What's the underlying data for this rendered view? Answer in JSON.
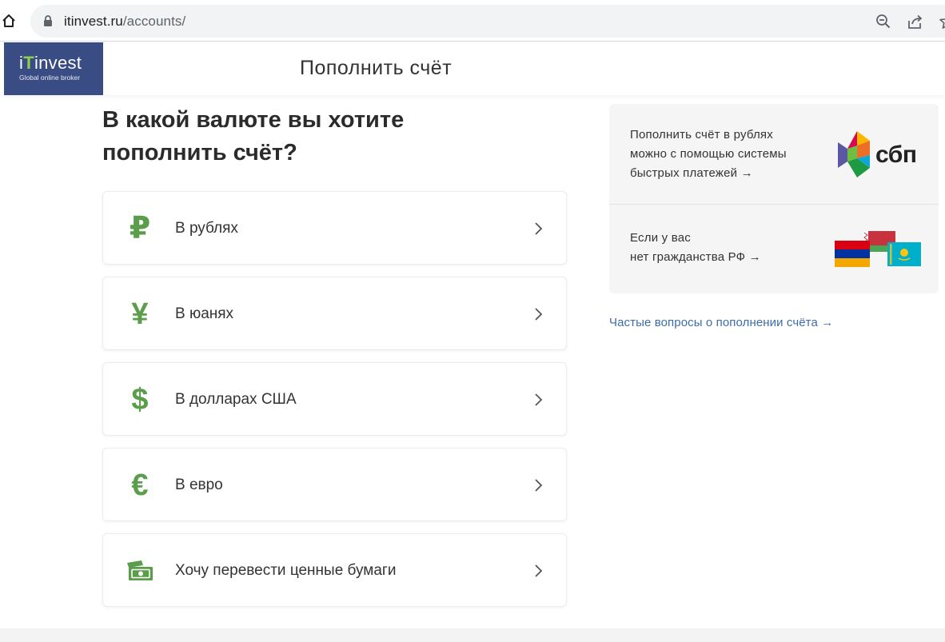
{
  "browser": {
    "url_host": "itinvest.ru",
    "url_path": "/accounts/"
  },
  "header": {
    "logo_main_prefix": "i",
    "logo_main_t": "T",
    "logo_main_rest": "invest",
    "logo_sub": "Global online broker",
    "title": "Пополнить счёт"
  },
  "main": {
    "question_line1": "В какой валюте вы хотите",
    "question_line2": "пополнить счёт?",
    "options": [
      {
        "icon": "ruble-icon",
        "symbol": "₽",
        "label": "В рублях"
      },
      {
        "icon": "yuan-icon",
        "symbol": "¥",
        "label": "В юанях"
      },
      {
        "icon": "dollar-icon",
        "symbol": "$",
        "label": "В долларах США"
      },
      {
        "icon": "euro-icon",
        "symbol": "€",
        "label": "В евро"
      },
      {
        "icon": "securities-icon",
        "symbol": "",
        "label": "Хочу перевести ценные бумаги"
      }
    ]
  },
  "side": {
    "sbp_line1": "Пополнить счёт в рублях",
    "sbp_line2": "можно с помощью системы",
    "sbp_line3": "быстрых платежей →",
    "sbp_logo_text": "сбп",
    "nonres_line1": "Если у вас",
    "nonres_line2": "нет гражданства РФ →",
    "faq_link": "Частые вопросы о пополнении счёта →"
  },
  "colors": {
    "accent_green": "#5a9e4b",
    "logo_bg": "#3a4c84",
    "link_blue": "#3e6da6"
  }
}
